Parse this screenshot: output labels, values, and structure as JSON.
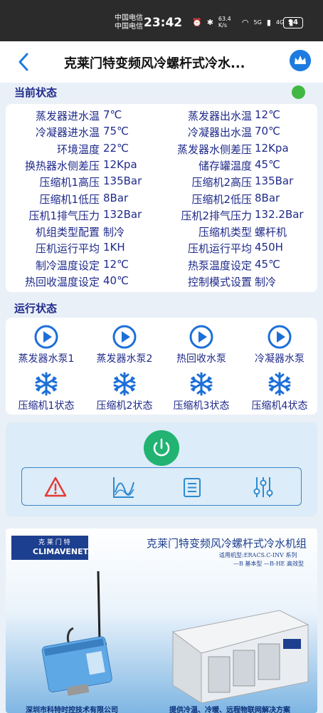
{
  "status_bar": {
    "carrier1": "中国电信",
    "carrier2": "中国电信",
    "time": "23:42",
    "speed": "63.4 K/s",
    "net1": "5G",
    "net2": "4G",
    "battery": "94"
  },
  "header": {
    "title": "克莱门特变频风冷螺杆式冷水..."
  },
  "current_status": {
    "title": "当前状态",
    "indicator_color": "#40b843",
    "rows": [
      {
        "l1": "蒸发器进水温",
        "v1": "7℃",
        "l2": "蒸发器出水温",
        "v2": "12℃"
      },
      {
        "l1": "冷凝器进水温",
        "v1": "75℃",
        "l2": "冷凝器出水温",
        "v2": "70℃"
      },
      {
        "l1": "环境温度",
        "v1": "22℃",
        "l2": "蒸发器水侧差压",
        "v2": "12Kpa"
      },
      {
        "l1": "换热器水侧差压",
        "v1": "12Kpa",
        "l2": "储存罐温度",
        "v2": "45℃"
      },
      {
        "l1": "压缩机1高压",
        "v1": "135Bar",
        "l2": "压缩机2高压",
        "v2": "135Bar"
      },
      {
        "l1": "压缩机1低压",
        "v1": "8Bar",
        "l2": "压缩机2低压",
        "v2": "8Bar"
      },
      {
        "l1": "压机1排气压力",
        "v1": "132Bar",
        "l2": "压机2排气压力",
        "v2": "132.2Bar"
      },
      {
        "l1": "机组类型配置",
        "v1": "制冷",
        "l2": "压缩机类型",
        "v2": "螺杆机"
      },
      {
        "l1": "压机运行平均",
        "v1": "1KH",
        "l2": "压机运行平均",
        "v2": "450H"
      },
      {
        "l1": "制冷温度设定",
        "v1": "12℃",
        "l2": "热泵温度设定",
        "v2": "45℃"
      },
      {
        "l1": "热回收温度设定",
        "v1": "40℃",
        "l2": "控制模式设置",
        "v2": "制冷"
      }
    ]
  },
  "run_status": {
    "title": "运行状态",
    "pumps": [
      {
        "label": "蒸发器水泵1",
        "icon": "play-icon"
      },
      {
        "label": "蒸发器水泵2",
        "icon": "play-icon"
      },
      {
        "label": "热回收水泵",
        "icon": "play-icon"
      },
      {
        "label": "冷凝器水泵",
        "icon": "play-icon"
      }
    ],
    "compressors": [
      {
        "label": "压缩机1状态",
        "icon": "snowflake-icon"
      },
      {
        "label": "压缩机2状态",
        "icon": "snowflake-icon"
      },
      {
        "label": "压缩机3状态",
        "icon": "snowflake-icon"
      },
      {
        "label": "压缩机4状态",
        "icon": "snowflake-icon"
      }
    ]
  },
  "controls": {
    "power_icon": "power-icon",
    "tools": [
      "alarm-icon",
      "chart-icon",
      "list-icon",
      "settings-sliders-icon"
    ]
  },
  "ad": {
    "logo_top": "克 莱 门 特",
    "logo_bottom": "CLIMAVENETA",
    "title": "克莱门特变频风冷螺杆式冷水机组",
    "sub1": "适用机型:ERACS.C-INV 系列",
    "sub2": "—B 基本型 —B-HE 高效型",
    "footer_left": "深圳市科特时控技术有限公司",
    "footer_right": "提供冷温、冷暖、远程物联网解决方案"
  },
  "colors": {
    "accent": "#1d7be0",
    "text": "#1f2a8a",
    "power": "#22b372",
    "alarm": "#e53935"
  }
}
